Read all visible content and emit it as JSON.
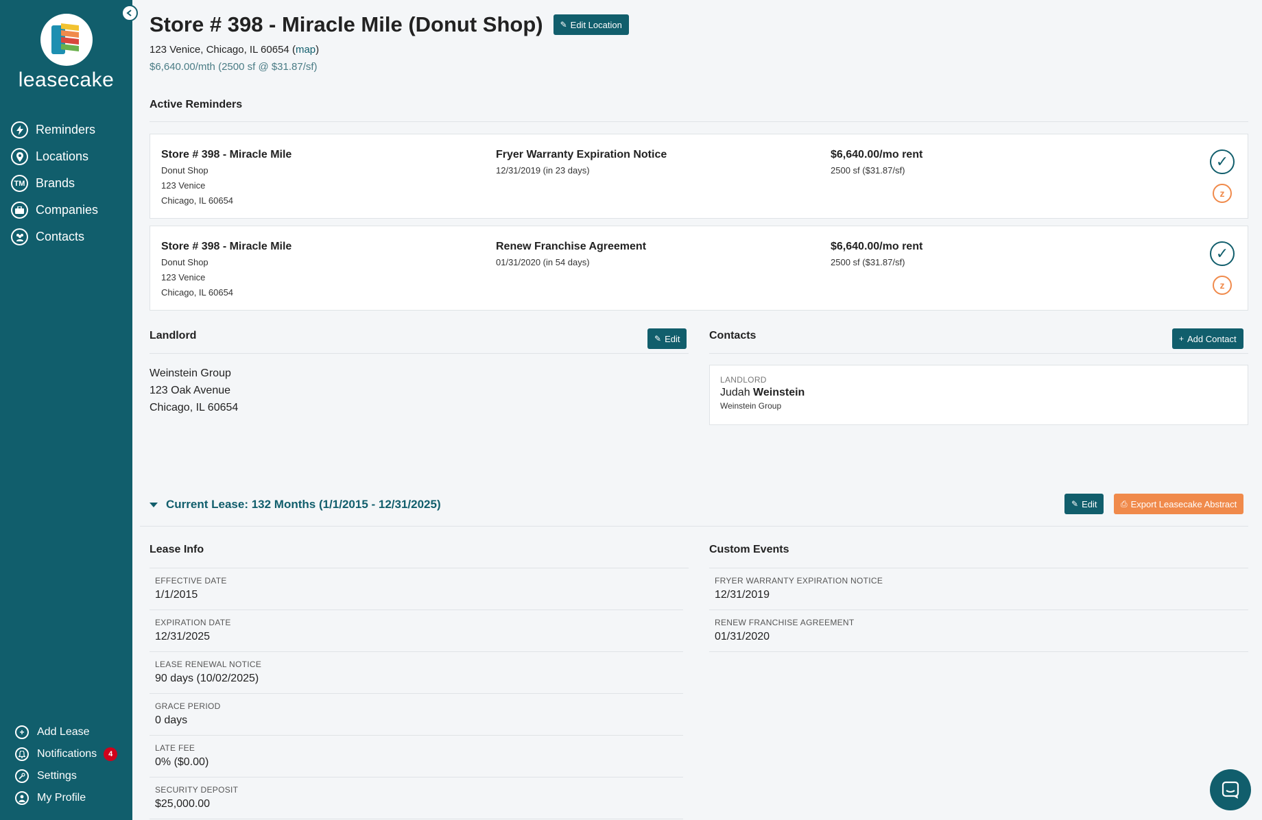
{
  "brand": {
    "name": "leasecake",
    "colors": {
      "primary": "#115e6c",
      "accent": "#f08a4b",
      "badge": "#d0021b"
    }
  },
  "sidebar": {
    "items": [
      {
        "icon": "bolt-icon",
        "label": "Reminders"
      },
      {
        "icon": "map-pin-icon",
        "label": "Locations"
      },
      {
        "icon": "trademark-icon",
        "label": "Brands"
      },
      {
        "icon": "briefcase-icon",
        "label": "Companies"
      },
      {
        "icon": "people-icon",
        "label": "Contacts"
      }
    ],
    "bottom": [
      {
        "icon": "plus-circle-icon",
        "label": "Add Lease"
      },
      {
        "icon": "bell-icon",
        "label": "Notifications",
        "badge": "4"
      },
      {
        "icon": "wrench-icon",
        "label": "Settings"
      },
      {
        "icon": "user-icon",
        "label": "My Profile"
      }
    ]
  },
  "header": {
    "title": "Store # 398 - Miracle Mile (Donut Shop)",
    "edit_location": "Edit Location",
    "address": "123 Venice, Chicago, IL 60654",
    "map_link": "map",
    "rent_summary": "$6,640.00/mth (2500 sf @ $31.87/sf)"
  },
  "reminders": {
    "heading": "Active Reminders",
    "items": [
      {
        "store": "Store # 398 - Miracle Mile",
        "brand": "Donut Shop",
        "street": "123 Venice",
        "city": "Chicago, IL 60654",
        "event": "Fryer Warranty Expiration Notice",
        "date": "12/31/2019 (in 23 days)",
        "rent": "$6,640.00/mo rent",
        "area": "2500 sf ($31.87/sf)"
      },
      {
        "store": "Store # 398 - Miracle Mile",
        "brand": "Donut Shop",
        "street": "123 Venice",
        "city": "Chicago, IL 60654",
        "event": "Renew Franchise Agreement",
        "date": "01/31/2020 (in 54 days)",
        "rent": "$6,640.00/mo rent",
        "area": "2500 sf ($31.87/sf)"
      }
    ]
  },
  "landlord": {
    "heading": "Landlord",
    "edit": "Edit",
    "name": "Weinstein Group",
    "street": "123 Oak Avenue",
    "city": "Chicago, IL 60654"
  },
  "contacts": {
    "heading": "Contacts",
    "add": "Add Contact",
    "items": [
      {
        "role": "LANDLORD",
        "first": "Judah",
        "last": "Weinstein",
        "company": "Weinstein Group"
      }
    ]
  },
  "lease": {
    "toggle": "Current Lease: 132 Months (1/1/2015 - 12/31/2025)",
    "edit": "Edit",
    "export": "Export Leasecake Abstract",
    "info_heading": "Lease Info",
    "info": [
      {
        "label": "EFFECTIVE DATE",
        "value": "1/1/2015"
      },
      {
        "label": "EXPIRATION DATE",
        "value": "12/31/2025"
      },
      {
        "label": "LEASE RENEWAL NOTICE",
        "value": "90 days (10/02/2025)"
      },
      {
        "label": "GRACE PERIOD",
        "value": "0 days"
      },
      {
        "label": "LATE FEE",
        "value": "0% ($0.00)"
      },
      {
        "label": "SECURITY DEPOSIT",
        "value": "$25,000.00"
      }
    ],
    "events_heading": "Custom Events",
    "events": [
      {
        "label": "FRYER WARRANTY EXPIRATION NOTICE",
        "value": "12/31/2019"
      },
      {
        "label": "RENEW FRANCHISE AGREEMENT",
        "value": "01/31/2020"
      }
    ]
  }
}
